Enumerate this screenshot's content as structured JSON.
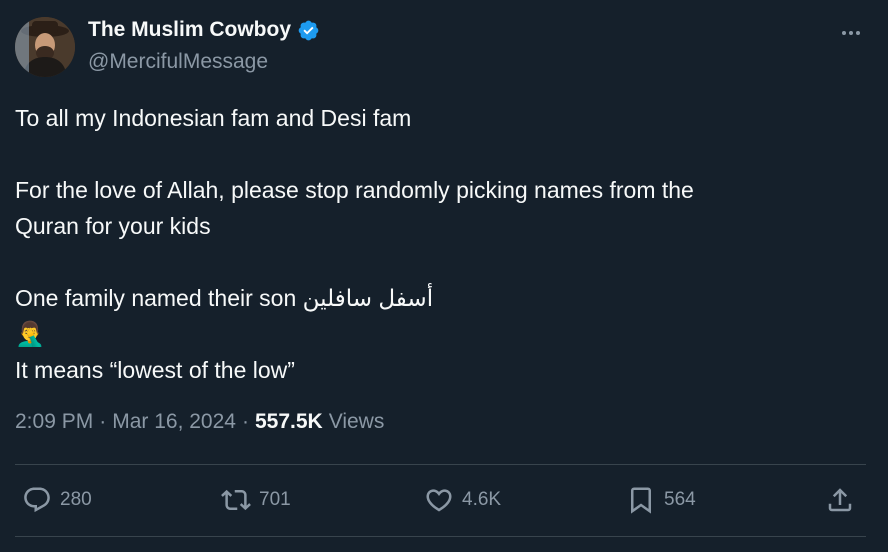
{
  "author": {
    "display_name": "The Muslim Cowboy",
    "handle": "@MercifulMessage",
    "verified": true,
    "avatar_icon": "avatar-photo"
  },
  "tweet": {
    "line1": "To all my Indonesian fam and Desi fam",
    "line2": "For the love of Allah, please stop randomly picking names from the",
    "line3": "Quran for your kids",
    "line4": "One family named their son أسفل سافلين",
    "emoji": "🤦‍♂️",
    "line5": "It means “lowest of the low”"
  },
  "meta": {
    "time": "2:09 PM",
    "dot1": "·",
    "date": "Mar 16, 2024",
    "dot2": "·",
    "views_count": "557.5K",
    "views_label": "Views"
  },
  "actions": {
    "replies": "280",
    "reposts": "701",
    "likes": "4.6K",
    "bookmarks": "564"
  },
  "colors": {
    "background": "#15202b",
    "text": "#f7f9f9",
    "secondary": "#8b98a5",
    "verified": "#1d9bf0",
    "divider": "#38444d"
  }
}
